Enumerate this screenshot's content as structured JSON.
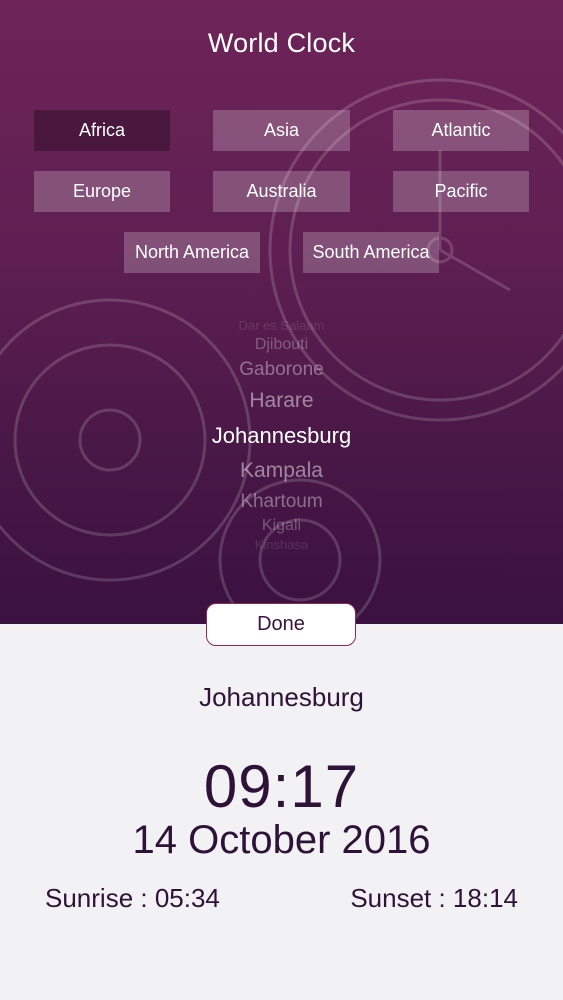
{
  "header": {
    "title": "World Clock"
  },
  "regions": [
    {
      "label": "Africa",
      "selected": true
    },
    {
      "label": "Asia",
      "selected": false
    },
    {
      "label": "Atlantic",
      "selected": false
    },
    {
      "label": "Europe",
      "selected": false
    },
    {
      "label": "Australia",
      "selected": false
    },
    {
      "label": "Pacific",
      "selected": false
    },
    {
      "label": "North America",
      "selected": false
    },
    {
      "label": "South America",
      "selected": false
    }
  ],
  "picker": {
    "items": [
      "Dar es Salaam",
      "Djibouti",
      "Gaborone",
      "Harare",
      "Johannesburg",
      "Kampala",
      "Khartoum",
      "Kigali",
      "Kinshasa"
    ],
    "selected": "Johannesburg"
  },
  "done_label": "Done",
  "clock": {
    "city": "Johannesburg",
    "time": "09:17",
    "date": "14 October 2016",
    "sunrise": "Sunrise : 05:34",
    "sunset": "Sunset : 18:14"
  },
  "colors": {
    "background_top": "#6e2458",
    "background_bottom": "#3a1140",
    "panel": "#f2f1f4",
    "text_dark": "#2e1238",
    "done_border": "#8a2a55"
  }
}
